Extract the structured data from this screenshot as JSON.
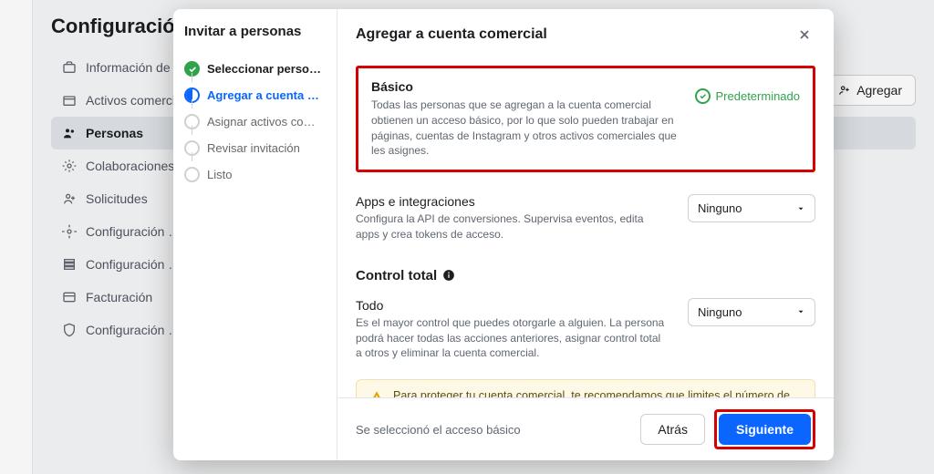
{
  "bg": {
    "title": "Configuración",
    "nav": [
      "Información de la…",
      "Activos comercial…",
      "Personas",
      "Colaboraciones p…",
      "Solicitudes",
      "Configuración …",
      "Configuración …",
      "Facturación",
      "Configuración …"
    ],
    "top_button": "Agregar"
  },
  "modal": {
    "steps_title": "Invitar a personas",
    "steps": [
      "Seleccionar personas",
      "Agregar a cuenta c…",
      "Asignar activos co…",
      "Revisar invitación",
      "Listo"
    ],
    "header": "Agregar a cuenta comercial",
    "basic": {
      "title": "Básico",
      "desc": "Todas las personas que se agregan a la cuenta comercial obtienen un acceso básico, por lo que solo pueden trabajar en páginas, cuentas de Instagram y otros activos comerciales que les asignes.",
      "default_label": "Predeterminado"
    },
    "apps": {
      "title": "Apps e integraciones",
      "desc": "Configura la API de conversiones. Supervisa eventos, edita apps y crea tokens de acceso.",
      "select": "Ninguno"
    },
    "full_section": "Control total",
    "todo": {
      "title": "Todo",
      "desc": "Es el mayor control que puedes otorgarle a alguien. La persona podrá hacer todas las acciones anteriores, asignar control total a otros y eliminar la cuenta comercial.",
      "select": "Ninguno"
    },
    "warning": "Para proteger tu cuenta comercial, te recomendamos que limites el número de personas que tienen control sobre tu negocio.",
    "footer_note": "Se seleccionó el acceso básico",
    "back": "Atrás",
    "next": "Siguiente"
  }
}
